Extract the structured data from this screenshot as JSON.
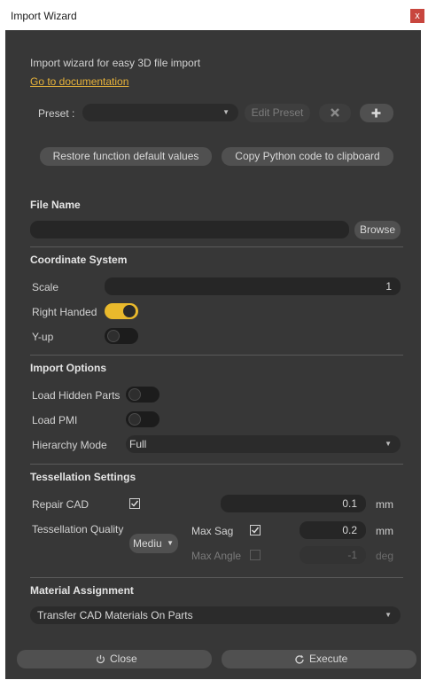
{
  "window": {
    "title": "Import Wizard",
    "close_glyph": "x"
  },
  "intro": {
    "text": "Import wizard for easy 3D file import",
    "doc_link": "Go to documentation"
  },
  "preset": {
    "label": "Preset :",
    "value": "",
    "edit_label": "Edit Preset",
    "delete_icon": "x-mark-icon",
    "add_icon": "plus-icon"
  },
  "actions": {
    "restore_label": "Restore function default values",
    "copy_label": "Copy Python code to clipboard"
  },
  "file": {
    "heading": "File Name",
    "value": "",
    "browse_label": "Browse"
  },
  "coords": {
    "heading": "Coordinate System",
    "scale_label": "Scale",
    "scale_value": "1",
    "right_handed_label": "Right Handed",
    "right_handed_on": true,
    "yup_label": "Y-up",
    "yup_on": false
  },
  "import_options": {
    "heading": "Import Options",
    "hidden_label": "Load Hidden Parts",
    "hidden_on": false,
    "pmi_label": "Load PMI",
    "pmi_on": false,
    "hierarchy_label": "Hierarchy Mode",
    "hierarchy_value": "Full"
  },
  "tessellation": {
    "heading": "Tessellation Settings",
    "repair_label": "Repair CAD",
    "repair_checked": true,
    "repair_value": "0.1",
    "repair_unit": "mm",
    "quality_label": "Tessellation Quality",
    "quality_value": "Mediu",
    "maxsag_label": "Max Sag",
    "maxsag_checked": true,
    "maxsag_value": "0.2",
    "maxsag_unit": "mm",
    "maxangle_label": "Max Angle",
    "maxangle_checked": false,
    "maxangle_value": "-1",
    "maxangle_unit": "deg"
  },
  "material": {
    "heading": "Material Assignment",
    "value": "Transfer CAD Materials On Parts"
  },
  "footer": {
    "close_label": "Close",
    "execute_label": "Execute"
  },
  "colors": {
    "panel": "#373737",
    "accent": "#e9b92c",
    "link": "#e6b23a",
    "close_button": "#c8463e"
  }
}
